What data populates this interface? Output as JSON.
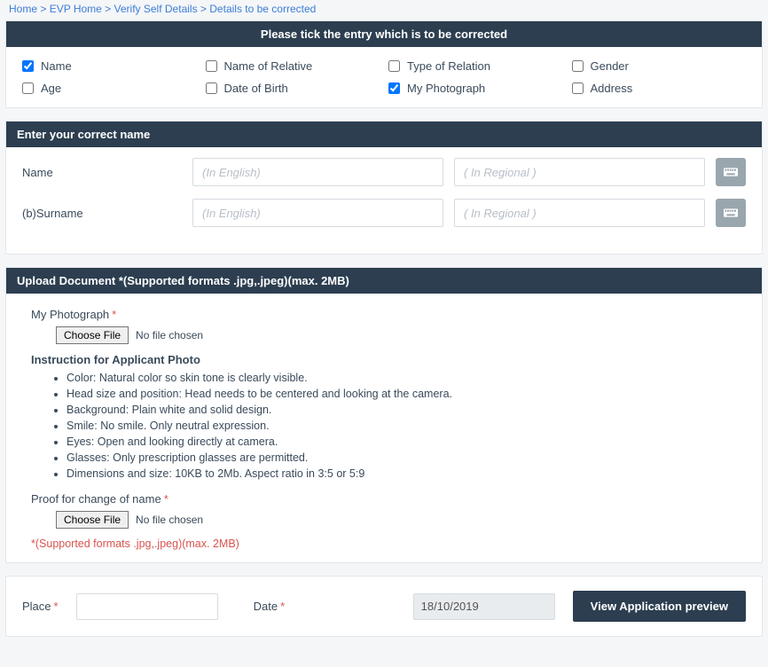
{
  "breadcrumb": {
    "a": "Home",
    "b": "EVP Home",
    "c": "Verify Self Details",
    "d": "Details to be corrected"
  },
  "tick": {
    "header": "Please tick the entry which is to be corrected",
    "items": [
      {
        "label": "Name",
        "checked": true
      },
      {
        "label": "Name of Relative",
        "checked": false
      },
      {
        "label": "Type of Relation",
        "checked": false
      },
      {
        "label": "Gender",
        "checked": false
      },
      {
        "label": "Age",
        "checked": false
      },
      {
        "label": "Date of Birth",
        "checked": false
      },
      {
        "label": "My Photograph",
        "checked": true
      },
      {
        "label": "Address",
        "checked": false
      }
    ]
  },
  "correctName": {
    "header": "Enter your correct name",
    "rows": [
      {
        "label": "Name",
        "ph_en": "(In English)",
        "ph_reg": "( In Regional )"
      },
      {
        "label": "(b)Surname",
        "ph_en": "(In English)",
        "ph_reg": "( In Regional )"
      }
    ]
  },
  "upload": {
    "header": "Upload Document *(Supported formats .jpg,.jpeg)(max. 2MB)",
    "photo_label": "My Photograph",
    "choose": "Choose File",
    "nofile": "No file chosen",
    "instr_head": "Instruction for Applicant Photo",
    "instr": [
      "Color: Natural color so skin tone is clearly visible.",
      "Head size and position: Head needs to be centered and looking at the camera.",
      "Background: Plain white and solid design.",
      "Smile: No smile. Only neutral expression.",
      "Eyes: Open and looking directly at camera.",
      "Glasses: Only prescription glasses are permitted.",
      "Dimensions and size: 10KB to 2Mb. Aspect ratio in 3:5 or 5:9"
    ],
    "proof_label": "Proof for change of name",
    "warn": "*(Supported formats .jpg,.jpeg)(max. 2MB)"
  },
  "footer": {
    "place_label": "Place",
    "date_label": "Date",
    "date_value": "18/10/2019",
    "preview": "View Application preview"
  }
}
